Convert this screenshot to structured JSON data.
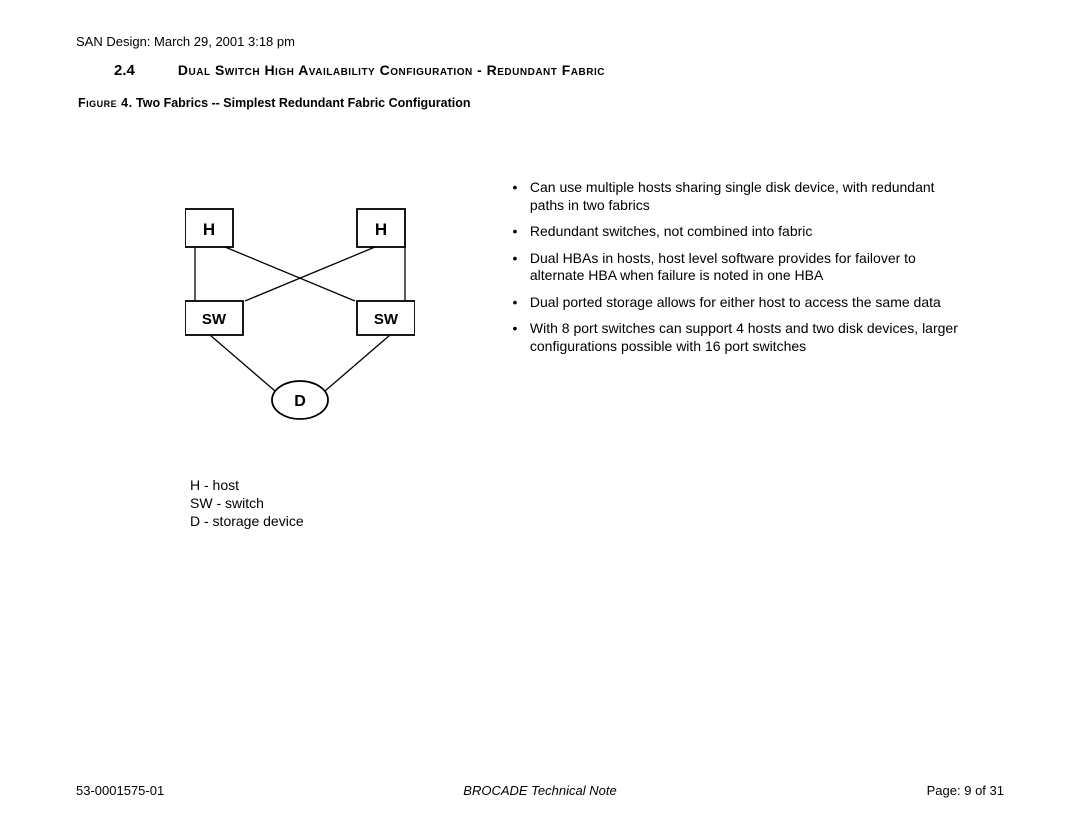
{
  "header": "SAN Design:  March 29, 2001 3:18 pm",
  "section": {
    "number": "2.4",
    "title": "Dual Switch High Availability Configuration - Redundant Fabric"
  },
  "figure": {
    "prefix": "Figure  4.",
    "caption": "Two Fabrics -- Simplest Redundant Fabric Configuration"
  },
  "diagram": {
    "host1": "H",
    "host2": "H",
    "switch1": "SW",
    "switch2": "SW",
    "device": "D"
  },
  "bullets": [
    "Can use multiple hosts sharing single disk device, with redundant paths in two fabrics",
    "Redundant switches, not combined into fabric",
    "Dual HBAs in hosts, host level software provides for failover to alternate HBA when failure is noted in one HBA",
    "Dual ported storage allows for either host to access the same data",
    "With 8 port switches can support 4 hosts and two disk devices, larger configurations possible with 16 port switches"
  ],
  "legend": [
    "H - host",
    "SW - switch",
    "D - storage device"
  ],
  "footer": {
    "left": "53-0001575-01",
    "center": "BROCADE Technical Note",
    "right_prefix": "Page:  ",
    "page_current": "9",
    "page_sep": " of ",
    "page_total": "31"
  }
}
